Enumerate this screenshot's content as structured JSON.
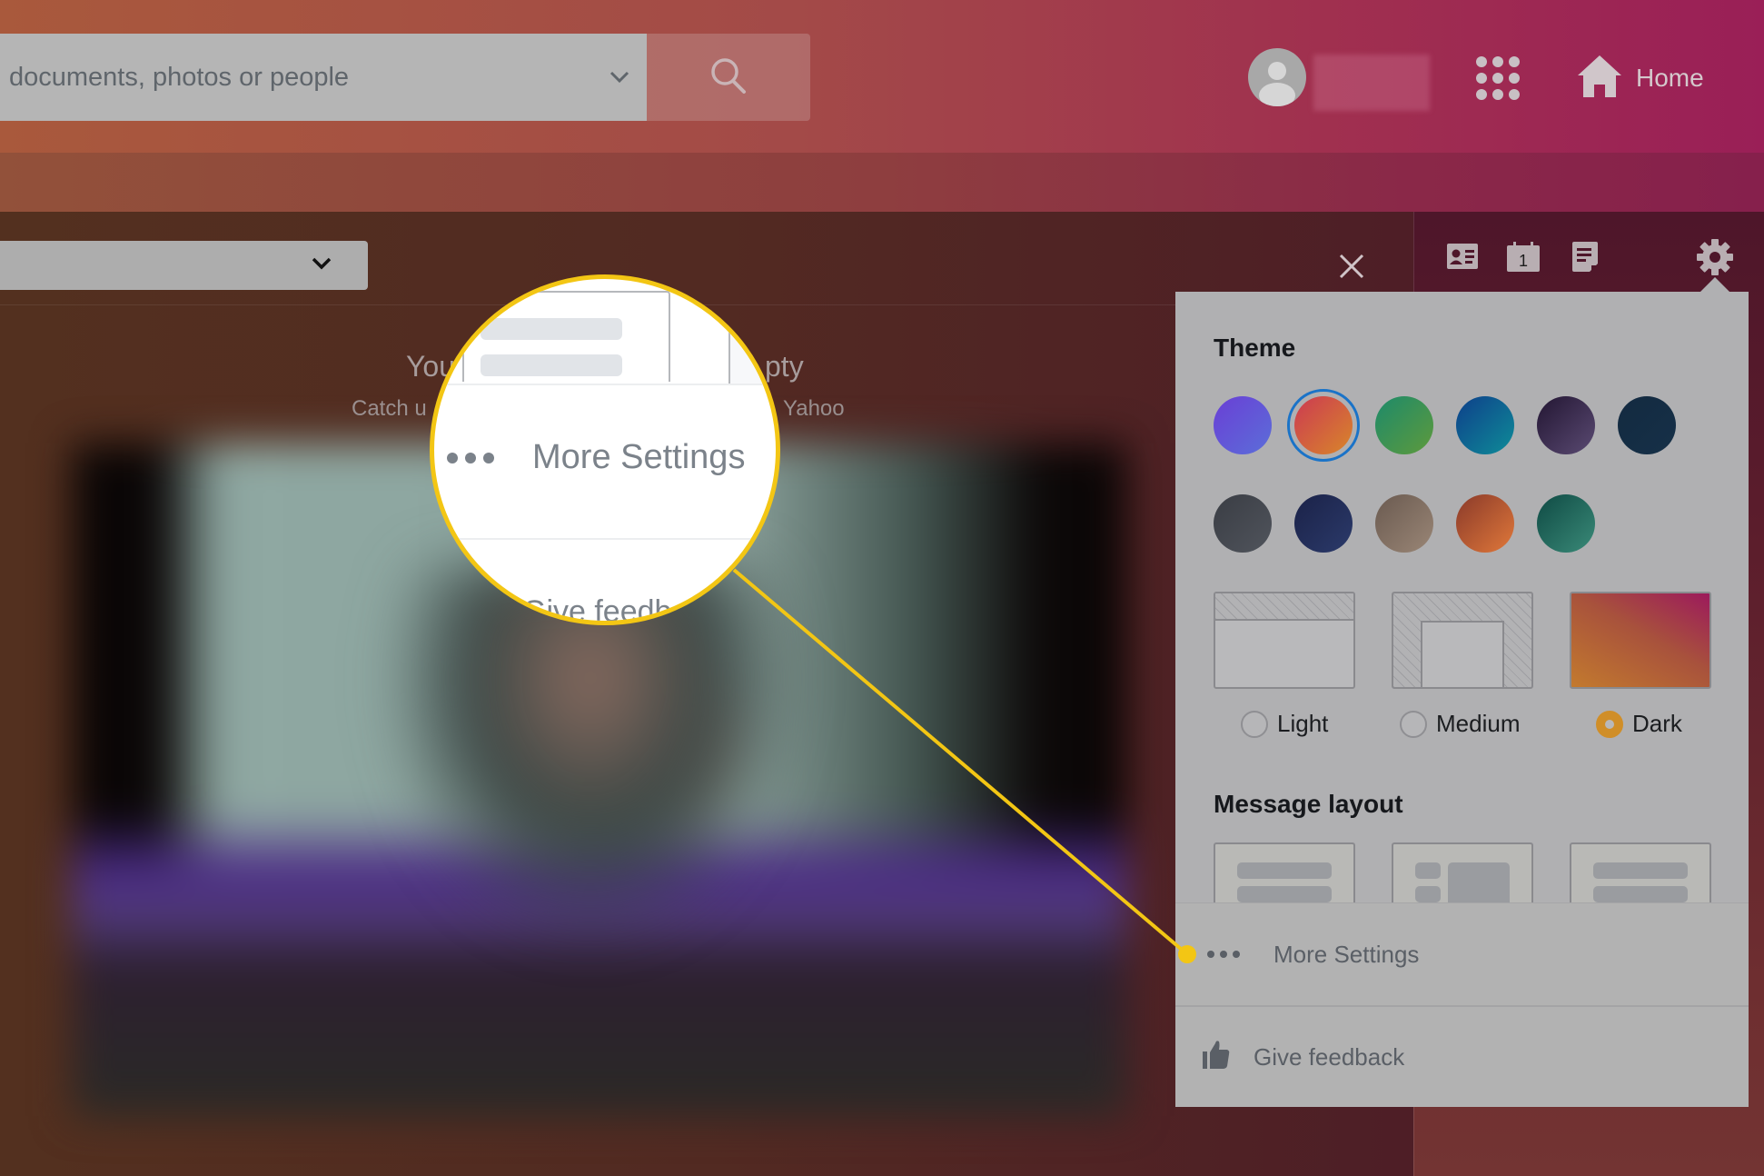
{
  "search": {
    "placeholder": "documents, photos or people",
    "dropdown_icon": "chevron-down-icon",
    "button_icon": "search-icon"
  },
  "header": {
    "avatar_icon": "user-avatar-icon",
    "apps_icon": "apps-grid-icon",
    "home_label": "Home",
    "home_icon": "home-icon"
  },
  "toolbar": {
    "folder_dropdown_icon": "chevron-down-icon",
    "close_icon": "close-icon",
    "contacts_icon": "contacts-card-icon",
    "calendar_icon": "calendar-icon",
    "calendar_day": "1",
    "notepad_icon": "notepad-icon",
    "settings_icon": "gear-icon"
  },
  "empty_state": {
    "title_left": "You",
    "title_right": "pty",
    "subtitle_left": "Catch u",
    "subtitle_right": "Yahoo"
  },
  "settings_panel": {
    "theme_heading": "Theme",
    "theme_swatches": [
      {
        "name": "purple",
        "colors": [
          "#5b6ed8",
          "#6a3fd6"
        ],
        "selected": false
      },
      {
        "name": "sunset",
        "colors": [
          "#d8862a",
          "#cc3a52"
        ],
        "selected": true
      },
      {
        "name": "green",
        "colors": [
          "#5e9a3c",
          "#1d8a6a"
        ],
        "selected": false
      },
      {
        "name": "ocean",
        "colors": [
          "#0f8c98",
          "#0d3f8a"
        ],
        "selected": false
      },
      {
        "name": "plum",
        "colors": [
          "#5a4a72",
          "#231633"
        ],
        "selected": false
      },
      {
        "name": "navy",
        "colors": [
          "#163048",
          "#132a40"
        ],
        "selected": false
      },
      {
        "name": "slate",
        "colors": [
          "#50545c",
          "#3a3d44"
        ],
        "selected": false
      },
      {
        "name": "mountains",
        "colors": [
          "#2b3a6a",
          "#1b2248"
        ],
        "selected": false
      },
      {
        "name": "camper-van",
        "colors": [
          "#9a8676",
          "#6a5a50"
        ],
        "selected": false
      },
      {
        "name": "desert-sunset",
        "colors": [
          "#e0783a",
          "#8a3a2a"
        ],
        "selected": false
      },
      {
        "name": "lake",
        "colors": [
          "#3a8a78",
          "#0f4a44"
        ],
        "selected": false
      }
    ],
    "modes": [
      {
        "label": "Light",
        "checked": false
      },
      {
        "label": "Medium",
        "checked": false
      },
      {
        "label": "Dark",
        "checked": true
      }
    ],
    "selected_radio_color": "#d08e28",
    "selected_swatch_ring_color": "#1a73c8",
    "layout_heading": "Message layout",
    "more_settings_label": "More Settings",
    "more_settings_icon": "more-dots-icon",
    "feedback_label": "Give feedback",
    "feedback_icon": "thumbs-up-icon"
  },
  "callout": {
    "label": "More Settings",
    "partial_label": "Give feedb",
    "accent_color": "#f3c614"
  }
}
